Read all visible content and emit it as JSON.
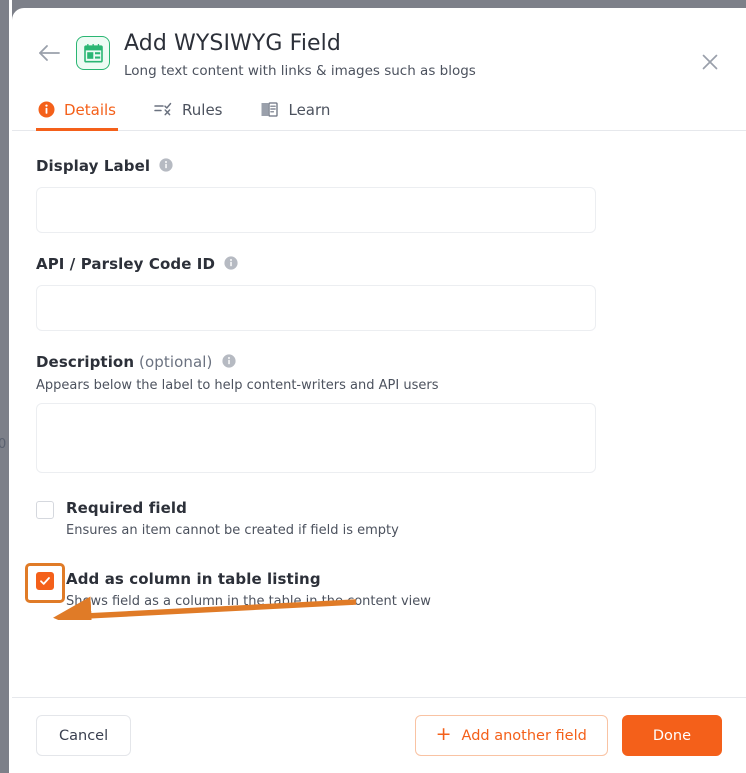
{
  "modal": {
    "title": "Add WYSIWYG Field",
    "subtitle": "Long text content with links & images such as blogs",
    "back_icon": "arrow-left-icon",
    "close_icon": "close-icon",
    "field_type_icon": "wysiwyg-field-icon",
    "accent_color": "#f4601a",
    "icon_color": "#2ab673",
    "highlight_color": "#e07b27"
  },
  "tabs": [
    {
      "label": "Details",
      "icon": "info-circle-icon",
      "active": true
    },
    {
      "label": "Rules",
      "icon": "rules-filter-icon",
      "active": false
    },
    {
      "label": "Learn",
      "icon": "book-icon",
      "active": false
    }
  ],
  "form": {
    "display_label": {
      "label": "Display Label",
      "info_icon": "info-icon",
      "value": "",
      "placeholder": ""
    },
    "api_code_id": {
      "label": "API / Parsley Code ID",
      "info_icon": "info-icon",
      "value": "",
      "placeholder": ""
    },
    "description": {
      "label": "Description",
      "optional_suffix": " (optional)",
      "info_icon": "info-icon",
      "help": "Appears below the label to help content-writers and API users",
      "value": "",
      "placeholder": ""
    },
    "required_field": {
      "title": "Required field",
      "subtitle": "Ensures an item cannot be created if field is empty",
      "checked": false
    },
    "add_as_column": {
      "title": "Add as column in table listing",
      "subtitle": "Shows field as a column in the table in the content view",
      "checked": true,
      "highlighted": true
    }
  },
  "footer": {
    "cancel_label": "Cancel",
    "add_another_label": "Add another field",
    "add_another_icon": "plus-icon",
    "done_label": "Done"
  },
  "background": {
    "partial_glyph": "0"
  }
}
